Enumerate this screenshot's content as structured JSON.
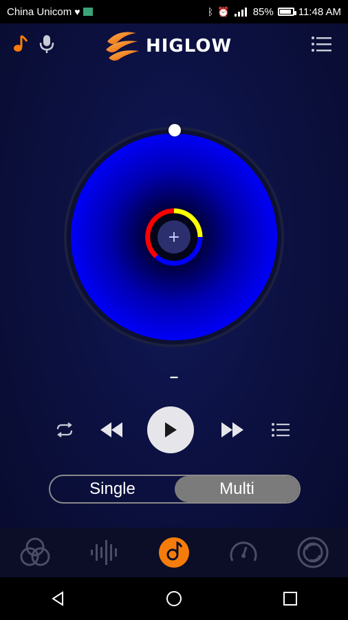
{
  "status": {
    "carrier": "China Unicom",
    "battery": "85%",
    "time": "11:48 AM"
  },
  "header": {
    "brand": "HIGLOW",
    "left_icons": [
      "music-note-icon",
      "microphone-icon"
    ],
    "right_icon": "menu-icon"
  },
  "player": {
    "song_title": "–",
    "center_button": "+",
    "ring_colors": [
      "#ffff00",
      "#0000ff",
      "#ff0000"
    ],
    "disc_color": "#0000ff"
  },
  "mode": {
    "options": [
      "Single",
      "Multi"
    ],
    "selected": "Multi"
  },
  "tabs": [
    {
      "icon": "color-circles-icon",
      "active": false
    },
    {
      "icon": "sound-wave-icon",
      "active": false
    },
    {
      "icon": "music-disc-icon",
      "active": true
    },
    {
      "icon": "speedometer-icon",
      "active": false
    },
    {
      "icon": "circle-settings-icon",
      "active": false
    }
  ],
  "colors": {
    "accent": "#f57c0a",
    "inactive_icon": "#4a4d66",
    "background": "#0b0f34"
  }
}
